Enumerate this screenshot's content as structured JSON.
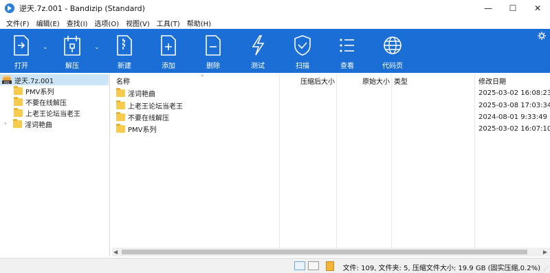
{
  "window": {
    "title": "逆天.7z.001 - Bandizip (Standard)",
    "minimize": "—",
    "maximize": "☐",
    "close": "✕"
  },
  "menu": [
    "文件(F)",
    "编辑(E)",
    "查找(I)",
    "选项(O)",
    "视图(V)",
    "工具(T)",
    "帮助(H)"
  ],
  "toolbar": {
    "open": "打开",
    "extract": "解压",
    "new": "新建",
    "add": "添加",
    "delete": "删除",
    "test": "测试",
    "scan": "扫描",
    "view": "查看",
    "codepage": "代码页",
    "accent": "#1a6ed6"
  },
  "tree": {
    "root": "逆天.7z.001",
    "root_badge": "001",
    "items": [
      "PMV系列",
      "不要在线解压",
      "上老王论坛当老王",
      "淫词艳曲"
    ]
  },
  "list": {
    "columns": [
      "名称",
      "压缩后大小",
      "原始大小",
      "类型",
      "修改日期"
    ],
    "rows": [
      {
        "name": "淫词艳曲",
        "date": "2025-03-02 16:08:23"
      },
      {
        "name": "上老王论坛当老王",
        "date": "2025-03-08 17:03:34"
      },
      {
        "name": "不要在线解压",
        "date": "2024-08-01 9:33:49"
      },
      {
        "name": "PMV系列",
        "date": "2025-03-02 16:07:10"
      }
    ]
  },
  "status": {
    "text": "文件: 109, 文件夹: 5, 压缩文件大小: 19.9 GB (固实压缩,0.2%)"
  }
}
